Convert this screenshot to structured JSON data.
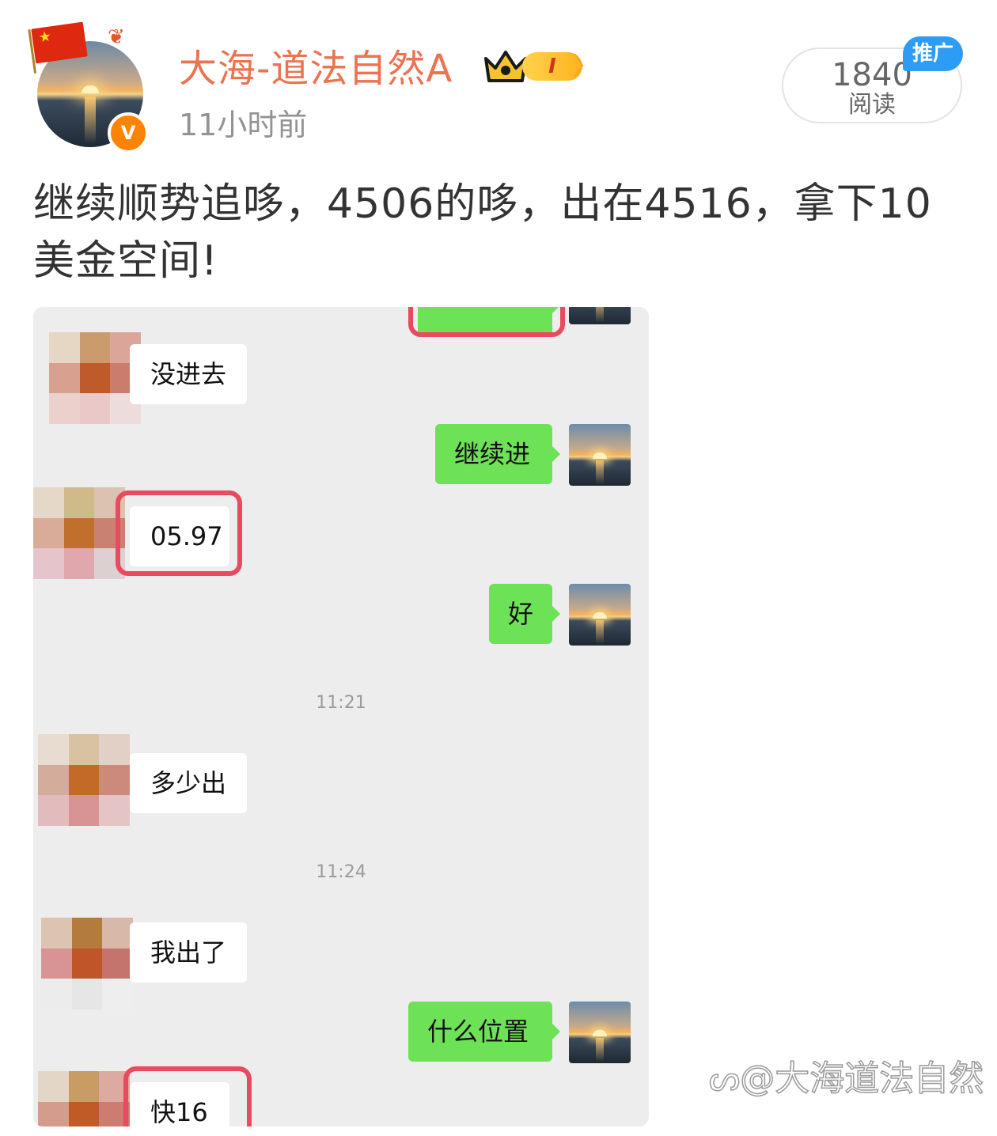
{
  "author": {
    "name": "大海-道法自然A",
    "time": "11小时前",
    "level": "I"
  },
  "stats": {
    "read_count": "1840",
    "read_label": "阅读",
    "promo_label": "推广"
  },
  "post": {
    "text": "继续顺势追哆，4506的哆，出在4516，拿下10美金空间!"
  },
  "chat": {
    "messages": [
      {
        "side": "left",
        "text": "没进去"
      },
      {
        "side": "right",
        "text": "继续进"
      },
      {
        "side": "left",
        "text": "05.97",
        "highlighted": true
      },
      {
        "side": "right",
        "text": "好"
      },
      {
        "side": "left",
        "text": "多少出"
      },
      {
        "side": "left",
        "text": "我出了"
      },
      {
        "side": "right",
        "text": "什么位置"
      },
      {
        "side": "left",
        "text": "快16",
        "highlighted": true
      }
    ],
    "timestamps": [
      "11:21",
      "11:24"
    ]
  },
  "watermark": "@大海道法自然",
  "colors": {
    "username": "#eb7350",
    "verified_badge": "#ff8200",
    "promo": "#2d9cf4",
    "bubble_right": "#6ee257",
    "highlight_box": "#e84a5f",
    "chat_background": "#ededed"
  },
  "icons": [
    "china-flag-icon",
    "verified-v-icon",
    "crown-icon",
    "sunset-avatar"
  ]
}
